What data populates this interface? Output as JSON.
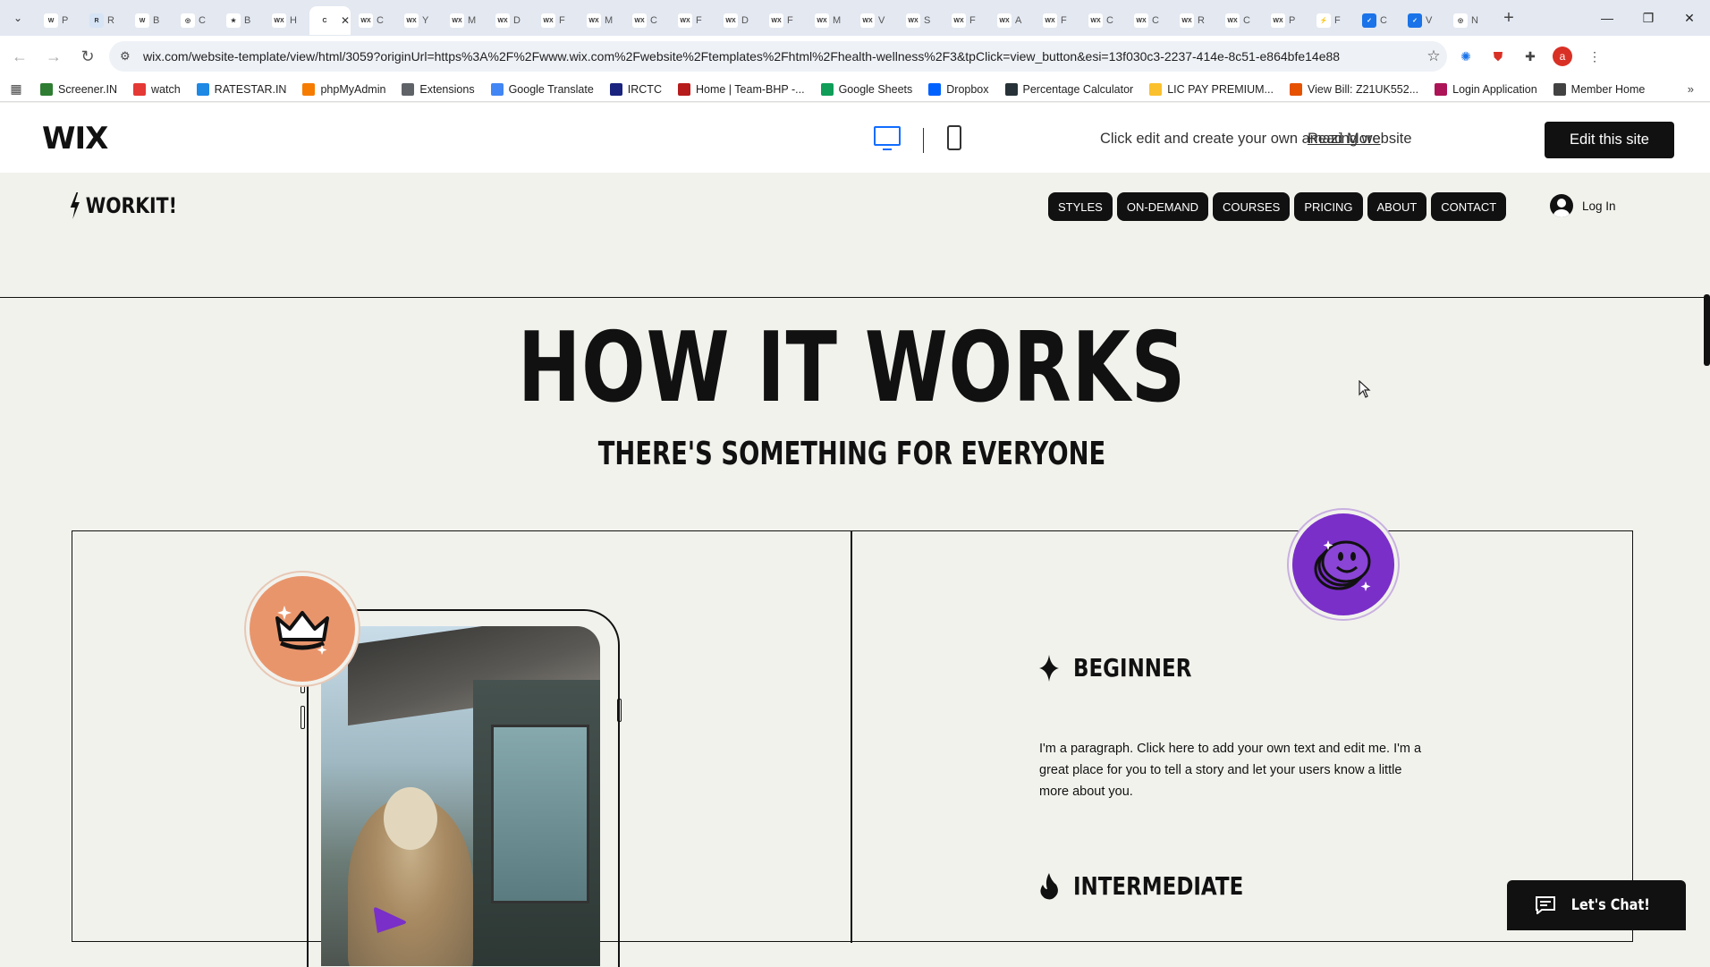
{
  "browser": {
    "tabs": [
      {
        "favicon": "W",
        "label": "P",
        "color": "#ffffff"
      },
      {
        "favicon": "R",
        "label": "R",
        "color": "#d6e4f5"
      },
      {
        "favicon": "W",
        "label": "B",
        "color": "#ffffff"
      },
      {
        "favicon": "◎",
        "label": "C",
        "color": "#ffffff"
      },
      {
        "favicon": "★",
        "label": "B",
        "color": "#ffffff"
      },
      {
        "favicon": "WX",
        "label": "H",
        "color": "#ffffff"
      },
      {
        "favicon": "C",
        "label": "",
        "color": "#ffffff",
        "active": true
      },
      {
        "favicon": "WX",
        "label": "C",
        "color": "#ffffff"
      },
      {
        "favicon": "WX",
        "label": "Y",
        "color": "#ffffff"
      },
      {
        "favicon": "WX",
        "label": "M",
        "color": "#ffffff"
      },
      {
        "favicon": "WX",
        "label": "D",
        "color": "#ffffff"
      },
      {
        "favicon": "WX",
        "label": "F",
        "color": "#ffffff"
      },
      {
        "favicon": "WX",
        "label": "M",
        "color": "#ffffff"
      },
      {
        "favicon": "WX",
        "label": "C",
        "color": "#ffffff"
      },
      {
        "favicon": "WX",
        "label": "F",
        "color": "#ffffff"
      },
      {
        "favicon": "WX",
        "label": "D",
        "color": "#ffffff"
      },
      {
        "favicon": "WX",
        "label": "F",
        "color": "#ffffff"
      },
      {
        "favicon": "WX",
        "label": "M",
        "color": "#ffffff"
      },
      {
        "favicon": "WX",
        "label": "V",
        "color": "#ffffff"
      },
      {
        "favicon": "WX",
        "label": "S",
        "color": "#ffffff"
      },
      {
        "favicon": "WX",
        "label": "F",
        "color": "#ffffff"
      },
      {
        "favicon": "WX",
        "label": "A",
        "color": "#ffffff"
      },
      {
        "favicon": "WX",
        "label": "F",
        "color": "#ffffff"
      },
      {
        "favicon": "WX",
        "label": "C",
        "color": "#ffffff"
      },
      {
        "favicon": "WX",
        "label": "C",
        "color": "#ffffff"
      },
      {
        "favicon": "WX",
        "label": "R",
        "color": "#ffffff"
      },
      {
        "favicon": "WX",
        "label": "C",
        "color": "#ffffff"
      },
      {
        "favicon": "WX",
        "label": "P",
        "color": "#ffffff"
      },
      {
        "favicon": "⚡",
        "label": "F",
        "color": "#ffffff"
      },
      {
        "favicon": "✓",
        "label": "C",
        "color": "#1a73e8"
      },
      {
        "favicon": "✓",
        "label": "V",
        "color": "#1a73e8"
      },
      {
        "favicon": "◎",
        "label": "N",
        "color": "#ffffff"
      }
    ],
    "url": "wix.com/website-template/view/html/3059?originUrl=https%3A%2F%2Fwww.wix.com%2Fwebsite%2Ftemplates%2Fhtml%2Fhealth-wellness%2F3&tpClick=view_button&esi=13f030c3-2237-414e-8c51-e864bfe14e88",
    "profile_initial": "a",
    "bookmarks": [
      {
        "label": "Screener.IN",
        "color": "#2e7d32"
      },
      {
        "label": "watch",
        "color": "#e53935"
      },
      {
        "label": "RATESTAR.IN",
        "color": "#1e88e5"
      },
      {
        "label": "phpMyAdmin",
        "color": "#f57c00"
      },
      {
        "label": "Extensions",
        "color": "#5f6368"
      },
      {
        "label": "Google Translate",
        "color": "#4285f4"
      },
      {
        "label": "IRCTC",
        "color": "#1a237e"
      },
      {
        "label": "Home | Team-BHP -...",
        "color": "#b71c1c"
      },
      {
        "label": "Google Sheets",
        "color": "#0f9d58"
      },
      {
        "label": "Dropbox",
        "color": "#0061ff"
      },
      {
        "label": "Percentage Calculator",
        "color": "#263238"
      },
      {
        "label": "LIC PAY PREMIUM...",
        "color": "#fbc02d"
      },
      {
        "label": "View Bill: Z21UK552...",
        "color": "#e65100"
      },
      {
        "label": "Login Application",
        "color": "#ad1457"
      },
      {
        "label": "Member Home",
        "color": "#424242"
      }
    ]
  },
  "wixbar": {
    "logo": "WIX",
    "tagline": "Click edit and create your own amazing website",
    "read_more": "Read More",
    "edit_button": "Edit this site",
    "accent": "#116dff"
  },
  "site": {
    "logo_text": "WORKIT!",
    "menu": [
      "STYLES",
      "ON-DEMAND",
      "COURSES",
      "PRICING",
      "ABOUT",
      "CONTACT"
    ],
    "login_label": "Log In",
    "heading": "HOW IT WORKS",
    "subheading": "THERE'S SOMETHING FOR EVERYONE",
    "levels": [
      {
        "icon": "sparkle-icon",
        "title": "BEGINNER"
      },
      {
        "icon": "flame-icon",
        "title": "INTERMEDIATE"
      }
    ],
    "paragraph": "I'm a paragraph. Click here to add your own text and edit me. I'm a great place for you to tell a story and let your users know a little more about you.",
    "chat_label": "Let's Chat!",
    "colors": {
      "background": "#f2f2ed",
      "badge_orange": "#e9956c",
      "badge_purple": "#7a2fc8",
      "ink": "#111111"
    }
  }
}
